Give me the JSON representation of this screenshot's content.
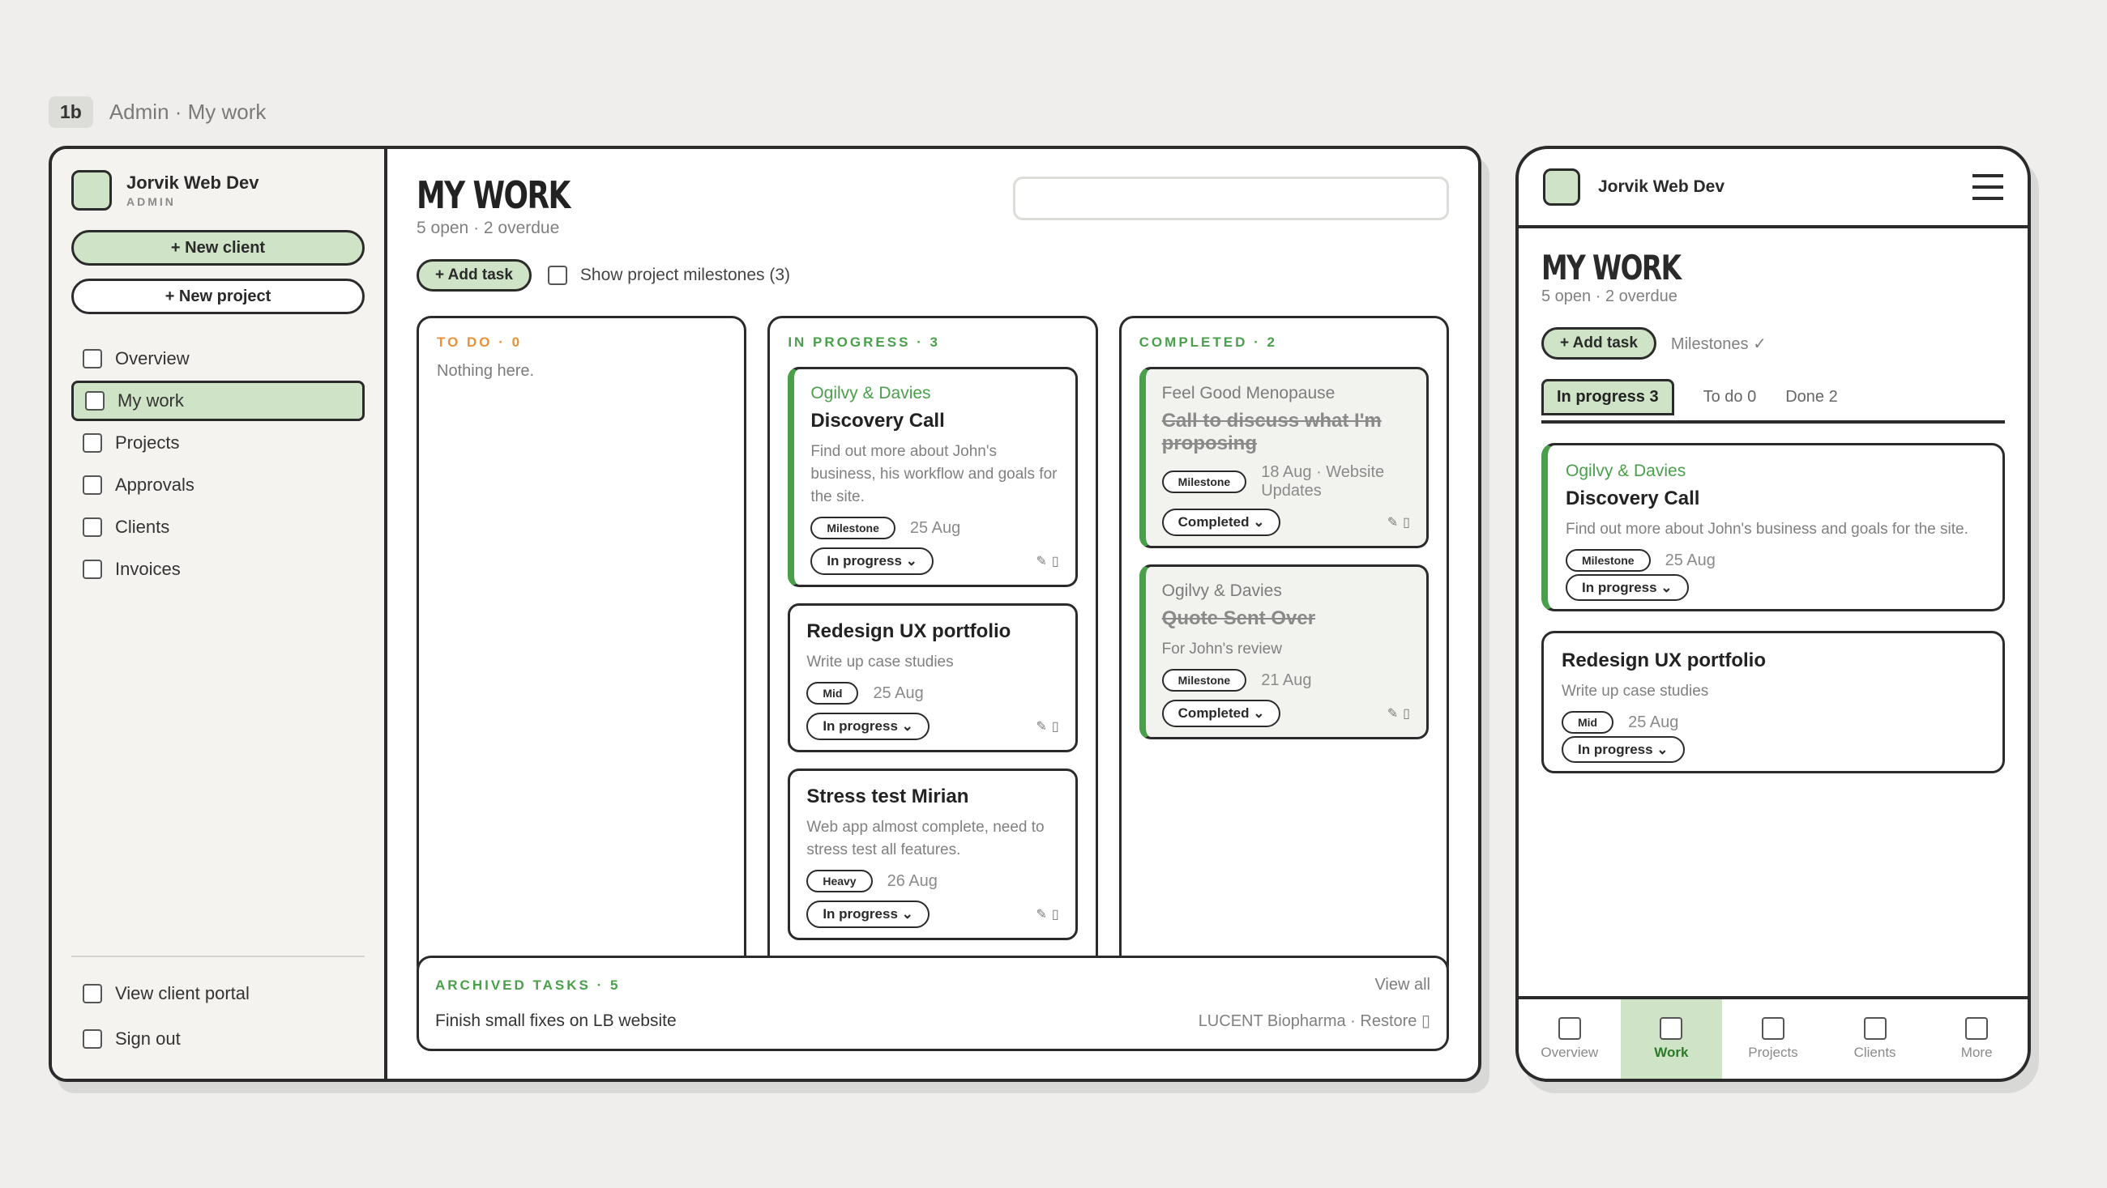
{
  "topbar": {
    "tag": "1b",
    "crumb": "Admin · My work"
  },
  "sidebar": {
    "brand": {
      "name": "Jorvik Web Dev",
      "role": "ADMIN"
    },
    "new_client": "+ New client",
    "new_project": "+ New project",
    "items": [
      {
        "label": "Overview"
      },
      {
        "label": "My work"
      },
      {
        "label": "Projects"
      },
      {
        "label": "Approvals"
      },
      {
        "label": "Clients"
      },
      {
        "label": "Invoices"
      }
    ],
    "bottom": [
      {
        "label": "View client portal"
      },
      {
        "label": "Sign out"
      }
    ]
  },
  "main": {
    "title": "MY WORK",
    "subtitle": "5 open · 2 overdue",
    "add_task": "+ Add task",
    "show_milestones": "Show project milestones (3)",
    "columns": {
      "todo": {
        "header": "TO DO · 0",
        "empty": "Nothing here."
      },
      "progress": {
        "header": "IN PROGRESS · 3",
        "cards": [
          {
            "client": "Ogilvy & Davies",
            "title": "Discovery Call",
            "desc": "Find out more about John's business, his workflow and goals for the site.",
            "chip": "Milestone",
            "date": "25 Aug",
            "status": "In progress ⌄"
          },
          {
            "title": "Redesign UX portfolio",
            "desc": "Write up case studies",
            "chip": "Mid",
            "date": "25 Aug",
            "status": "In progress ⌄"
          },
          {
            "title": "Stress test Mirian",
            "desc": "Web app almost complete, need to stress test all features.",
            "chip": "Heavy",
            "date": "26 Aug",
            "status": "In progress ⌄"
          }
        ]
      },
      "completed": {
        "header": "COMPLETED · 2",
        "cards": [
          {
            "client": "Feel Good Menopause",
            "title": "Call to discuss what I'm proposing",
            "chip": "Milestone",
            "date": "18 Aug · Website Updates",
            "status": "Completed ⌄"
          },
          {
            "client": "Ogilvy & Davies",
            "title": "Quote Sent Over",
            "desc": "For John's review",
            "chip": "Milestone",
            "date": "21 Aug",
            "status": "Completed ⌄"
          }
        ]
      }
    },
    "archived": {
      "header": "ARCHIVED TASKS · 5",
      "view_all": "View all",
      "task": "Finish small fixes on LB website",
      "meta": "LUCENT Biopharma · Restore"
    }
  },
  "mobile": {
    "brand": "Jorvik Web Dev",
    "title": "MY WORK",
    "subtitle": "5 open · 2 overdue",
    "add_task": "+ Add task",
    "milestones": "Milestones ✓",
    "tabs": [
      "In progress 3",
      "To do 0",
      "Done 2"
    ],
    "cards": [
      {
        "client": "Ogilvy & Davies",
        "title": "Discovery Call",
        "desc": "Find out more about John's business and goals for the site.",
        "chip": "Milestone",
        "date": "25 Aug",
        "status": "In progress ⌄"
      },
      {
        "title": "Redesign UX portfolio",
        "desc": "Write up case studies",
        "chip": "Mid",
        "date": "25 Aug",
        "status": "In progress ⌄"
      }
    ],
    "nav": [
      "Overview",
      "Work",
      "Projects",
      "Clients",
      "More"
    ]
  },
  "colors": {
    "accent_green": "#4aa04a",
    "soft_green": "#cfe3c6",
    "todo_orange": "#e8913a",
    "ink": "#2b2b2b"
  }
}
